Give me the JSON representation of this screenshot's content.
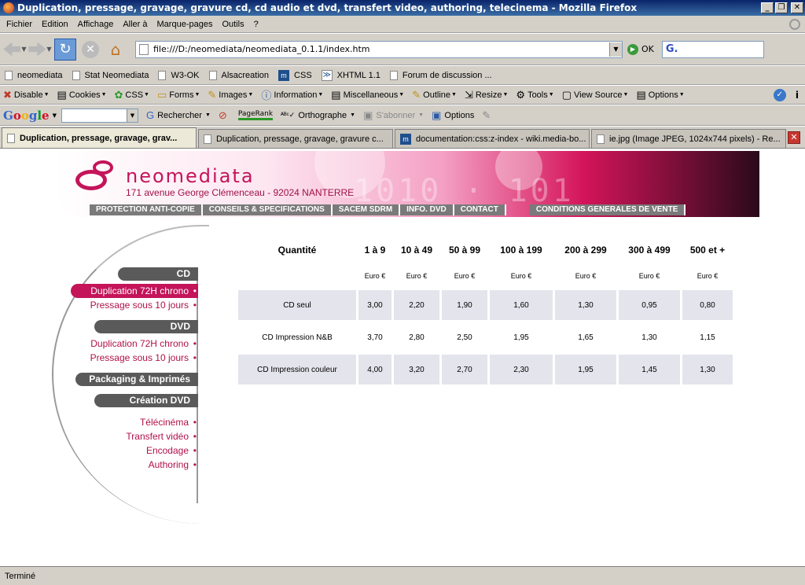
{
  "window": {
    "title": "Duplication, pressage, gravage, gravure cd, cd audio et dvd, transfert video, authoring, telecinema - Mozilla Firefox",
    "min_label": "_",
    "max_label": "❐",
    "close_label": "✕"
  },
  "menu": [
    "Fichier",
    "Edition",
    "Affichage",
    "Aller à",
    "Marque-pages",
    "Outils",
    "?"
  ],
  "nav": {
    "url": "file:///D:/neomediata/neomediata_0.1.1/index.htm",
    "go_label": "OK",
    "search_value": "G."
  },
  "bookmarks": [
    {
      "label": "neomediata",
      "icon": "page"
    },
    {
      "label": "Stat Neomediata",
      "icon": "page"
    },
    {
      "label": "W3-OK",
      "icon": "page"
    },
    {
      "label": "Alsacreation",
      "icon": "page"
    },
    {
      "label": "CSS",
      "icon": "m"
    },
    {
      "label": "XHTML 1.1",
      "icon": "x"
    },
    {
      "label": "Forum de discussion ...",
      "icon": "page"
    }
  ],
  "webdev": [
    {
      "label": "Disable",
      "icon": "✖"
    },
    {
      "label": "Cookies",
      "icon": "▤"
    },
    {
      "label": "CSS",
      "icon": "✿"
    },
    {
      "label": "Forms",
      "icon": "▭"
    },
    {
      "label": "Images",
      "icon": "✎"
    },
    {
      "label": "Information",
      "icon": "ⓘ"
    },
    {
      "label": "Miscellaneous",
      "icon": "▤"
    },
    {
      "label": "Outline",
      "icon": "✎"
    },
    {
      "label": "Resize",
      "icon": "⇲"
    },
    {
      "label": "Tools",
      "icon": "⚙"
    },
    {
      "label": "View Source",
      "icon": "▢"
    },
    {
      "label": "Options",
      "icon": "▤"
    }
  ],
  "google": {
    "logo": [
      "G",
      "o",
      "o",
      "g",
      "l",
      "e"
    ],
    "search_label": "Rechercher",
    "pagerank_label": "PageRank",
    "spell_label": "Orthographe",
    "subscribe_label": "S'abonner",
    "options_label": "Options"
  },
  "tabs": [
    {
      "label": "Duplication, pressage, gravage, grav...",
      "icon": "page",
      "active": true
    },
    {
      "label": "Duplication, pressage, gravage, gravure c...",
      "icon": "page",
      "active": false
    },
    {
      "label": "documentation:css:z-index - wiki.media-bo...",
      "icon": "m",
      "active": false
    },
    {
      "label": "ie.jpg (Image JPEG, 1024x744 pixels) - Re...",
      "icon": "page",
      "active": false
    }
  ],
  "site": {
    "brand": "neomediata",
    "address": "171 avenue George Clémenceau - 92024 NANTERRE",
    "topnav": [
      "PROTECTION ANTI-COPIE",
      "CONSEILS & SPECIFICATIONS",
      "SACEM SDRM",
      "INFO. DVD",
      "CONTACT",
      "CONDITIONS GENERALES DE VENTE"
    ],
    "brand_color": "#c4145a"
  },
  "sidebar": {
    "cd": {
      "title": "CD",
      "items": [
        "Duplication 72H chrono",
        "Pressage sous 10 jours"
      ]
    },
    "dvd": {
      "title": "DVD",
      "items": [
        "Duplication 72H chrono",
        "Pressage sous 10 jours"
      ]
    },
    "packaging": {
      "title": "Packaging & Imprimés"
    },
    "creation": {
      "title": "Création DVD",
      "items": [
        "Télécinéma",
        "Transfert vidéo",
        "Encodage",
        "Authoring"
      ]
    }
  },
  "table": {
    "headers": [
      "Quantité",
      "1 à 9",
      "10 à 49",
      "50 à 99",
      "100 à 199",
      "200 à 299",
      "300 à 499",
      "500 et +"
    ],
    "unit": "Euro €",
    "rows": [
      {
        "label": "CD seul",
        "values": [
          "3,00",
          "2,20",
          "1,90",
          "1,60",
          "1,30",
          "0,95",
          "0,80"
        ]
      },
      {
        "label": "CD Impression N&B",
        "values": [
          "3,70",
          "2,80",
          "2,50",
          "1,95",
          "1,65",
          "1,30",
          "1,15"
        ]
      },
      {
        "label": "CD Impression couleur",
        "values": [
          "4,00",
          "3,20",
          "2,70",
          "2,30",
          "1,95",
          "1,45",
          "1,30"
        ]
      }
    ]
  },
  "status": "Terminé"
}
